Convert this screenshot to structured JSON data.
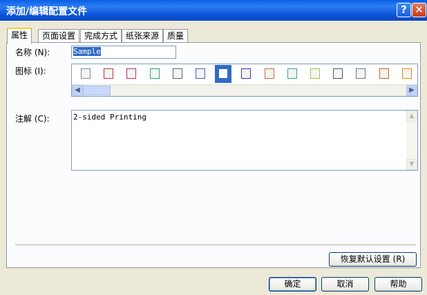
{
  "window": {
    "title": "添加/编辑配置文件"
  },
  "tabs": [
    {
      "label": "属性"
    },
    {
      "label": "页面设置"
    },
    {
      "label": "完成方式"
    },
    {
      "label": "纸张来源"
    },
    {
      "label": "质量"
    }
  ],
  "form": {
    "name_label": "名称 (N):",
    "name_value": "Sample",
    "icon_label": "图标 (I):",
    "comment_label": "注解 (C):",
    "comment_value": "2-sided Printing"
  },
  "icons": [
    "page-icon",
    "page-list-icon",
    "poster-icon",
    "photo-icon",
    "document-icon",
    "grid-icon",
    "booklet-icon",
    "a4-icon",
    "calendar-icon",
    "printer-icon",
    "color-icon",
    "report-icon",
    "text-icon",
    "stack-icon",
    "install-icon"
  ],
  "selected_icon_index": 6,
  "buttons": {
    "restore_defaults": "恢复默认设置 (R)",
    "ok": "确定",
    "cancel": "取消",
    "help": "帮助"
  },
  "colors": {
    "titlebar": "#0A5FE6",
    "selection": "#316AC5",
    "tab_highlight": "#FFC83C"
  }
}
